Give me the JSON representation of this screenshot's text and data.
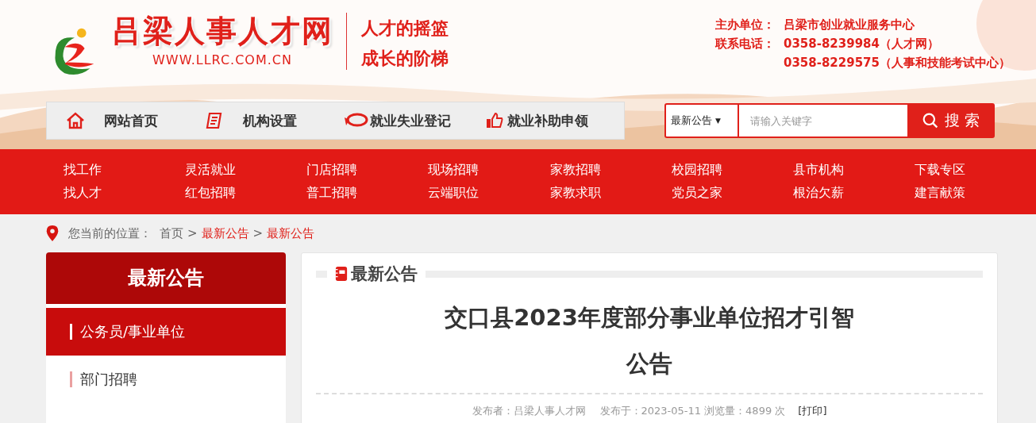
{
  "header": {
    "site_name": "吕梁人事人才网",
    "site_url": "WWW.LLRC.COM.CN",
    "slogans": [
      "人才的摇篮",
      "成长的阶梯"
    ],
    "contact": [
      {
        "label": "主办单位：",
        "value": "吕梁市创业就业服务中心"
      },
      {
        "label": "联系电话：",
        "value": "0358-8239984（人才网）"
      },
      {
        "value": "0358-8229575（人事和技能考试中心）"
      }
    ]
  },
  "main_nav": [
    {
      "kind": "home",
      "label": "网站首页"
    },
    {
      "kind": "doc",
      "label": "机构设置"
    },
    {
      "kind": "chat",
      "label": "就业失业登记"
    },
    {
      "kind": "thumb",
      "label": "就业补助申领"
    }
  ],
  "search": {
    "category": "最新公告",
    "caret": "▼",
    "placeholder": "请输入关键字",
    "button": "搜 索"
  },
  "category_nav": [
    [
      "找工作",
      "找人才"
    ],
    [
      "灵活就业",
      "红包招聘"
    ],
    [
      "门店招聘",
      "普工招聘"
    ],
    [
      "现场招聘",
      "云端职位"
    ],
    [
      "家教招聘",
      "家教求职"
    ],
    [
      "校园招聘",
      "党员之家"
    ],
    [
      "县市机构",
      "根治欠薪"
    ],
    [
      "下载专区",
      "建言献策"
    ]
  ],
  "breadcrumb": {
    "label": "您当前的位置：",
    "separator": ">",
    "items": [
      {
        "text": "首页",
        "highlight": false
      },
      {
        "text": "最新公告",
        "highlight": true
      },
      {
        "text": "最新公告",
        "highlight": true
      }
    ]
  },
  "sidebar": {
    "title": "最新公告",
    "items": [
      {
        "label": "公务员/事业单位",
        "selected": true
      },
      {
        "label": "部门招聘",
        "selected": false
      }
    ]
  },
  "article": {
    "section": "最新公告",
    "title_lines": [
      "交口县2023年度部分事业单位招才引智",
      "公告"
    ],
    "meta": {
      "publisher": "发布者：吕梁人事人才网",
      "date": "发布于：2023-05-11",
      "views": "浏览量：4899 次",
      "print": "[打印]"
    }
  }
}
